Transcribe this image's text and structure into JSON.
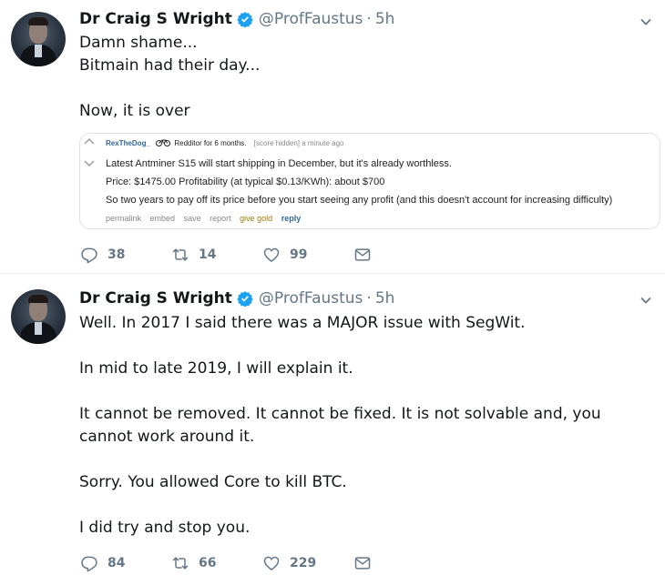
{
  "tweets": [
    {
      "name": "Dr Craig S Wright",
      "handle": "@ProfFaustus",
      "dot": "·",
      "time": "5h",
      "lines": [
        "Damn shame...",
        "Bitmain had their day...",
        "",
        "Now, it is over"
      ],
      "embed": {
        "username": "RexTheDog_",
        "flair": "Redditor for 6 months.",
        "meta": "[score hidden] a minute ago",
        "line1": "Latest Antminer S15 will start shipping in December, but it's already worthless.",
        "line2": "Price: $1475.00 Profitability (at typical $0.13/KWh): about $700",
        "line3": "So two years to pay off its price before you start seeing any profit (and this doesn't account for increasing difficulty)",
        "links": {
          "permalink": "permalink",
          "embed": "embed",
          "save": "save",
          "report": "report",
          "give_gold": "give gold",
          "reply": "reply"
        }
      },
      "counts": {
        "replies": "38",
        "retweets": "14",
        "likes": "99"
      }
    },
    {
      "name": "Dr Craig S Wright",
      "handle": "@ProfFaustus",
      "dot": "·",
      "time": "5h",
      "paragraphs": [
        "Well. In 2017 I said there was a MAJOR issue with SegWit.",
        "In mid to late 2019, I will explain it.",
        "It cannot be removed. It cannot be fixed. It is not solvable and, you cannot work around it.",
        "Sorry. You allowed Core to kill BTC.",
        "I did try and stop you."
      ],
      "counts": {
        "replies": "84",
        "retweets": "66",
        "likes": "229"
      }
    }
  ],
  "icons": {
    "verified": "verified-badge-icon",
    "caret": "chevron-down-icon",
    "reply": "reply-icon",
    "retweet": "retweet-icon",
    "like": "heart-icon",
    "dm": "envelope-icon"
  },
  "colors": {
    "verified": "#1da1f2",
    "secondary_text": "#657786",
    "primary_text": "#14171a"
  }
}
